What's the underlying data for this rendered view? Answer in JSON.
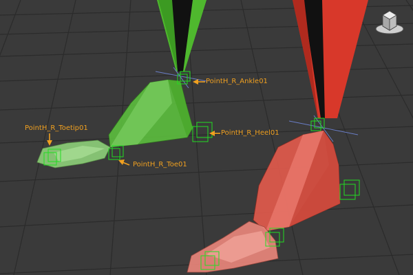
{
  "viewport": {
    "background": "#3a3a3a",
    "grid_color": "#2a2a2a",
    "label_color": "#f0a020"
  },
  "legs": {
    "right_leg_color": "#4fb82e",
    "right_leg_dark": "#1e4f12",
    "right_foot_light": "#8ed07a",
    "left_leg_color": "#d8382a",
    "left_leg_dark": "#5a120e",
    "left_foot_light": "#e8766a"
  },
  "helpers": {
    "ankle_label": "PointH_R_Ankle01",
    "heel_label": "PointH_R_Heel01",
    "toetip_label": "PointH_R_Toetip01",
    "toe_label": "PointH_R_Toe01",
    "helper_color": "#22dd22"
  },
  "viewcube": {
    "icon": "viewcube-icon"
  }
}
